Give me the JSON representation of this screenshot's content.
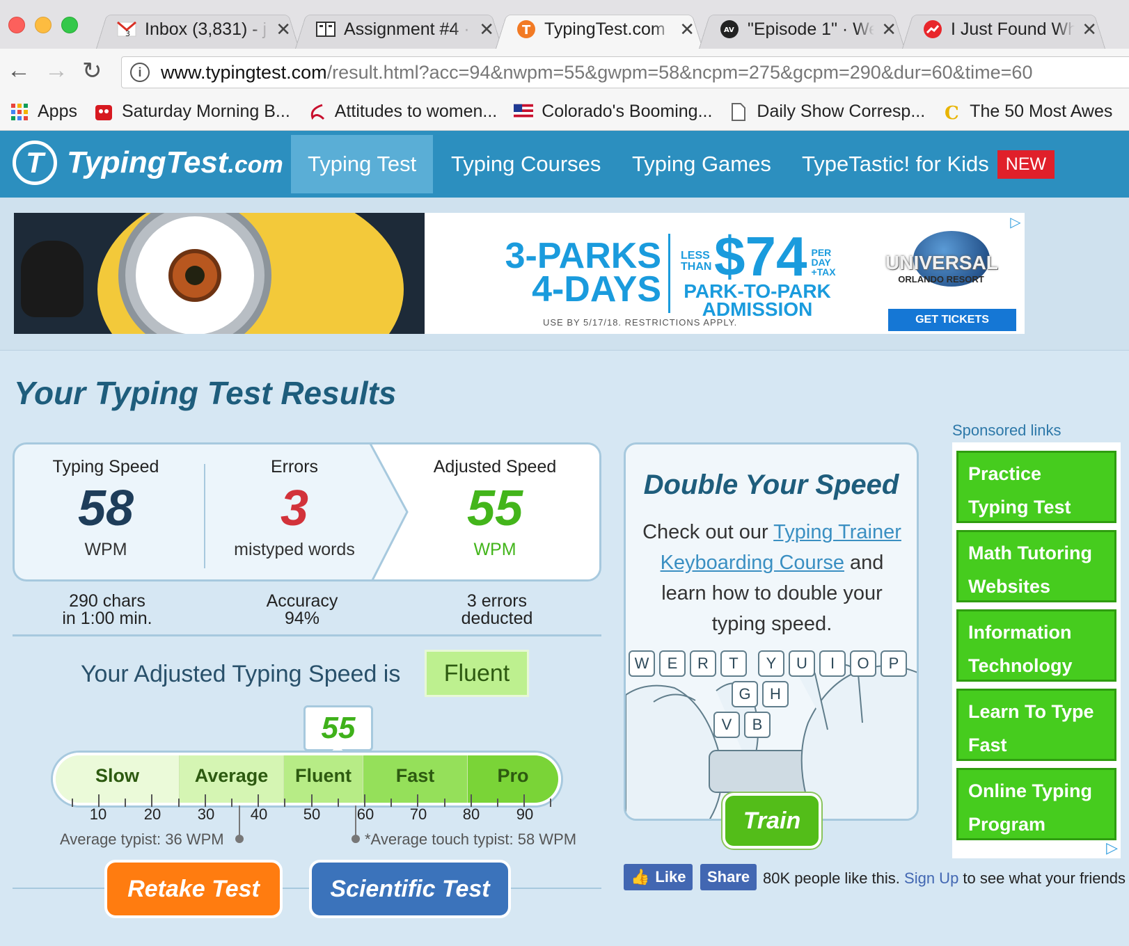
{
  "browser": {
    "tabs": [
      {
        "title": "Inbox (3,831) - j",
        "icon": "gmail-icon"
      },
      {
        "title": "Assignment #4 ·",
        "icon": "book-icon"
      },
      {
        "title": "TypingTest.com",
        "icon": "typingtest-icon",
        "active": true
      },
      {
        "title": "\"Episode 1\" · We",
        "icon": "avclub-icon"
      },
      {
        "title": "I Just Found Wh",
        "icon": "trending-icon"
      }
    ],
    "url_host": "www.typingtest.com",
    "url_path": "/result.html?acc=94&nwpm=55&gwpm=58&ncpm=275&gcpm=290&dur=60&time=60",
    "bookmarks": [
      {
        "label": "Apps",
        "icon": "apps-grid-icon"
      },
      {
        "label": "Saturday Morning B...",
        "icon": "smbc-icon"
      },
      {
        "label": "Attitudes to women...",
        "icon": "logo-icon"
      },
      {
        "label": "Colorado's Booming...",
        "icon": "flag-icon"
      },
      {
        "label": "Daily Show Corresp...",
        "icon": "page-icon"
      },
      {
        "label": "The 50 Most Awes",
        "icon": "cracked-icon"
      }
    ]
  },
  "site": {
    "logo_main": "TypingTest",
    "logo_suffix": ".com",
    "nav": [
      "Typing Test",
      "Typing Courses",
      "Typing Games",
      "TypeTastic! for Kids"
    ],
    "nav_badge": "NEW"
  },
  "ad": {
    "parks_line1": "3-PARKS",
    "parks_line2": "4-DAYS",
    "less_than": "LESS THAN",
    "price": "$74",
    "per_day": "PER DAY +TAX",
    "admission_line1": "PARK-TO-PARK",
    "admission_line2": "ADMISSION",
    "fine_print": "USE BY 5/17/18. RESTRICTIONS APPLY.",
    "brand": "UNIVERSAL",
    "brand_sub": "ORLANDO RESORT",
    "cta": "GET TICKETS"
  },
  "results": {
    "title": "Your Typing Test Results",
    "typing_speed_label": "Typing Speed",
    "typing_speed_value": "58",
    "typing_speed_unit": "WPM",
    "errors_label": "Errors",
    "errors_value": "3",
    "errors_unit": "mistyped words",
    "adjusted_label": "Adjusted Speed",
    "adjusted_value": "55",
    "adjusted_unit": "WPM",
    "chars_line1": "290 chars",
    "chars_line2": "in 1:00 min.",
    "accuracy_line1": "Accuracy",
    "accuracy_line2": "94%",
    "deducted_line1": "3 errors",
    "deducted_line2": "deducted",
    "adjusted_sentence": "Your Adjusted Typing Speed is",
    "level": "Fluent",
    "marker_value": "55",
    "scale_segments": [
      "Slow",
      "Average",
      "Fluent",
      "Fast",
      "Pro"
    ],
    "scale_ticks": [
      "10",
      "20",
      "30",
      "40",
      "50",
      "60",
      "70",
      "80",
      "90"
    ],
    "avg_typist": "Average typist: 36 WPM",
    "avg_touch_typist": "*Average touch typist: 58 WPM",
    "retake_button": "Retake Test",
    "scientific_button": "Scientific Test",
    "colors": {
      "title": "#1e5d7c",
      "speed": "#1e3d5a",
      "errors": "#d2323a",
      "adjusted": "#43b51b",
      "retake": "#ff7c10",
      "scientific": "#3b73bb"
    }
  },
  "double_speed": {
    "title": "Double Your Speed",
    "text_before": "Check out our ",
    "link": "Typing Trainer Keyboarding Course",
    "text_after": " and learn how to double your typing speed.",
    "keys_top": [
      "W",
      "E",
      "R",
      "T",
      "Y",
      "U",
      "I",
      "O",
      "P"
    ],
    "keys_mid": [
      "G",
      "H"
    ],
    "keys_bottom": [
      "V",
      "B"
    ],
    "train_button": "Train"
  },
  "sponsored": {
    "title": "Sponsored links",
    "items": [
      "Practice Typing Test",
      "Math Tutoring Websites",
      "Information Technology",
      "Learn To Type Fast",
      "Online Typing Program"
    ]
  },
  "social": {
    "like": "Like",
    "share": "Share",
    "text": "80K people like this.",
    "signup": "Sign Up",
    "text_after": " to see what your friends"
  }
}
